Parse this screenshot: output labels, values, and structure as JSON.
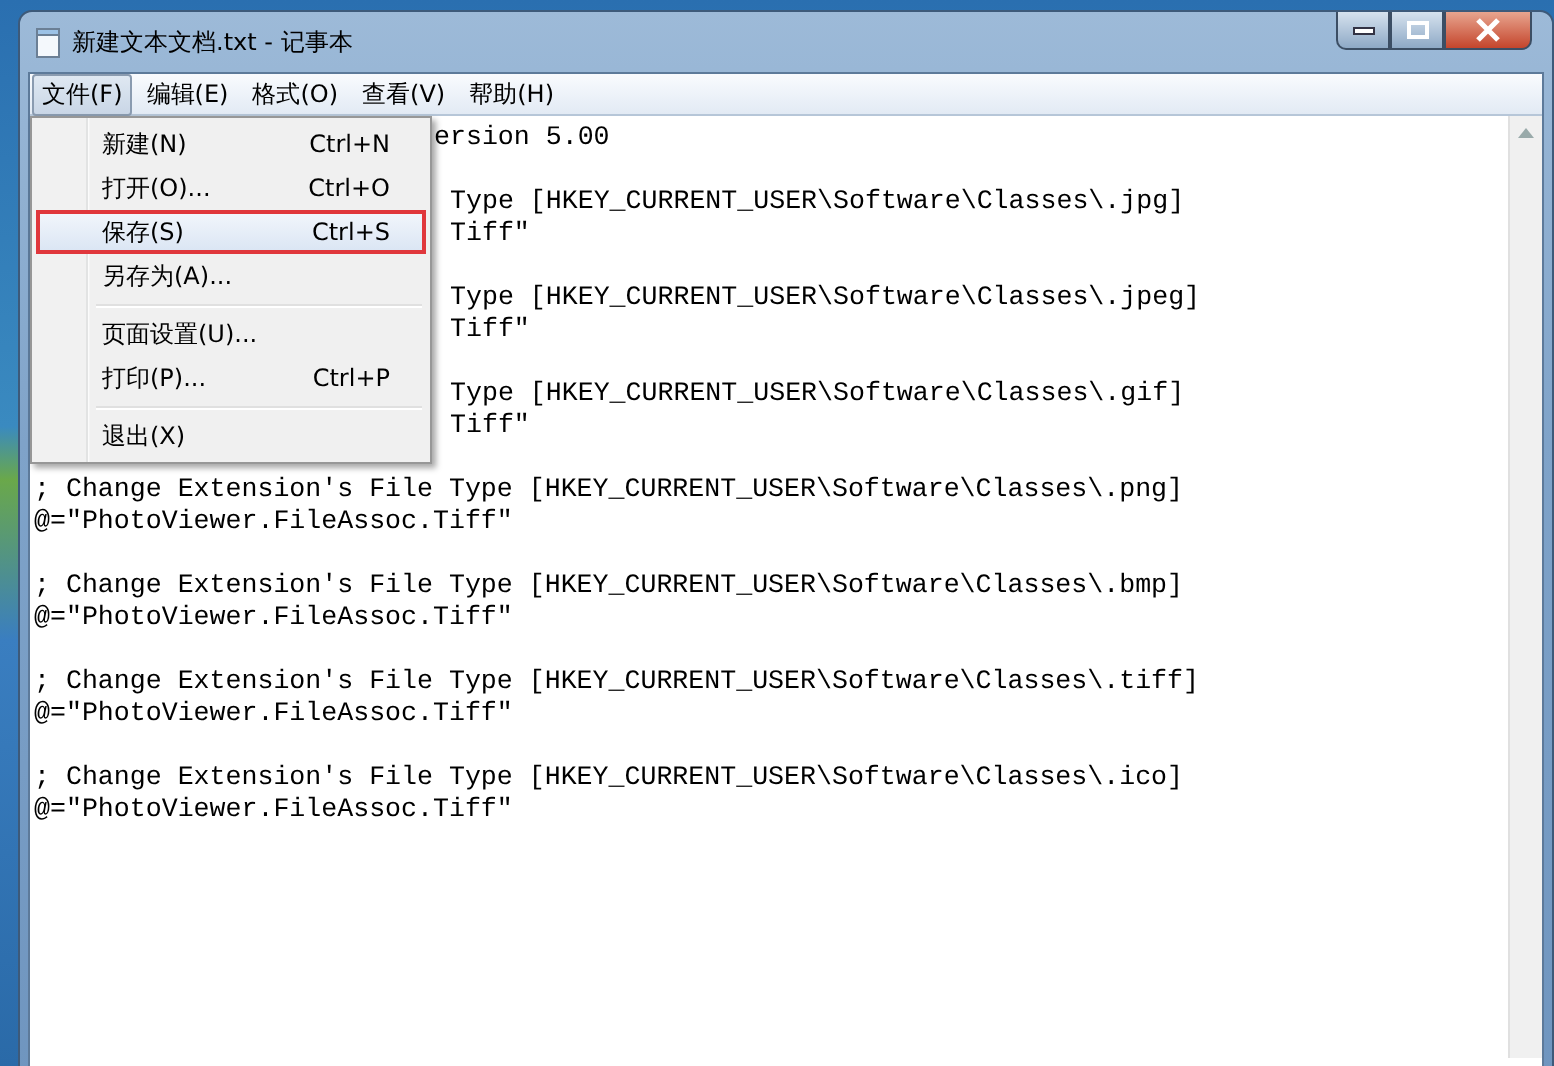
{
  "window": {
    "title": "新建文本文档.txt - 记事本"
  },
  "menu_bar": [
    {
      "label": "文件(F)",
      "selected": true
    },
    {
      "label": "编辑(E)",
      "selected": false
    },
    {
      "label": "格式(O)",
      "selected": false
    },
    {
      "label": "查看(V)",
      "selected": false
    },
    {
      "label": "帮助(H)",
      "selected": false
    }
  ],
  "file_menu": {
    "items": [
      {
        "kind": "item",
        "label": "新建(N)",
        "shortcut": "Ctrl+N",
        "selected": false
      },
      {
        "kind": "item",
        "label": "打开(O)...",
        "shortcut": "Ctrl+O",
        "selected": false
      },
      {
        "kind": "item",
        "label": "保存(S)",
        "shortcut": "Ctrl+S",
        "selected": true
      },
      {
        "kind": "item",
        "label": "另存为(A)...",
        "selected": false
      },
      {
        "kind": "separator"
      },
      {
        "kind": "item",
        "label": "页面设置(U)...",
        "selected": false
      },
      {
        "kind": "item",
        "label": "打印(P)...",
        "shortcut": "Ctrl+P",
        "selected": false
      },
      {
        "kind": "separator"
      },
      {
        "kind": "item",
        "label": "退出(X)",
        "selected": false
      }
    ]
  },
  "editor": {
    "lines": [
      {
        "kind": "header-tail",
        "text": "ersion 5.00"
      },
      {
        "kind": "blank"
      },
      {
        "kind": "entry-tail",
        "text": "Type [HKEY_CURRENT_USER\\Software\\Classes\\.jpg]"
      },
      {
        "kind": "entry-tail",
        "text": "Tiff\""
      },
      {
        "kind": "blank"
      },
      {
        "kind": "entry-tail",
        "text": "Type [HKEY_CURRENT_USER\\Software\\Classes\\.jpeg]"
      },
      {
        "kind": "entry-tail",
        "text": "Tiff\""
      },
      {
        "kind": "blank"
      },
      {
        "kind": "entry-tail",
        "text": "Type [HKEY_CURRENT_USER\\Software\\Classes\\.gif]"
      },
      {
        "kind": "entry-tail",
        "text": "Tiff\""
      },
      {
        "kind": "blank"
      },
      {
        "kind": "full",
        "text": "; Change Extension's File Type [HKEY_CURRENT_USER\\Software\\Classes\\.png]"
      },
      {
        "kind": "full",
        "text": "@=\"PhotoViewer.FileAssoc.Tiff\""
      },
      {
        "kind": "blank"
      },
      {
        "kind": "full",
        "text": "; Change Extension's File Type [HKEY_CURRENT_USER\\Software\\Classes\\.bmp]"
      },
      {
        "kind": "full",
        "text": "@=\"PhotoViewer.FileAssoc.Tiff\""
      },
      {
        "kind": "blank"
      },
      {
        "kind": "full",
        "text": "; Change Extension's File Type [HKEY_CURRENT_USER\\Software\\Classes\\.tiff]"
      },
      {
        "kind": "full",
        "text": "@=\"PhotoViewer.FileAssoc.Tiff\""
      },
      {
        "kind": "blank"
      },
      {
        "kind": "full",
        "text": "; Change Extension's File Type [HKEY_CURRENT_USER\\Software\\Classes\\.ico]"
      },
      {
        "kind": "full",
        "text": "@=\"PhotoViewer.FileAssoc.Tiff\""
      }
    ]
  }
}
